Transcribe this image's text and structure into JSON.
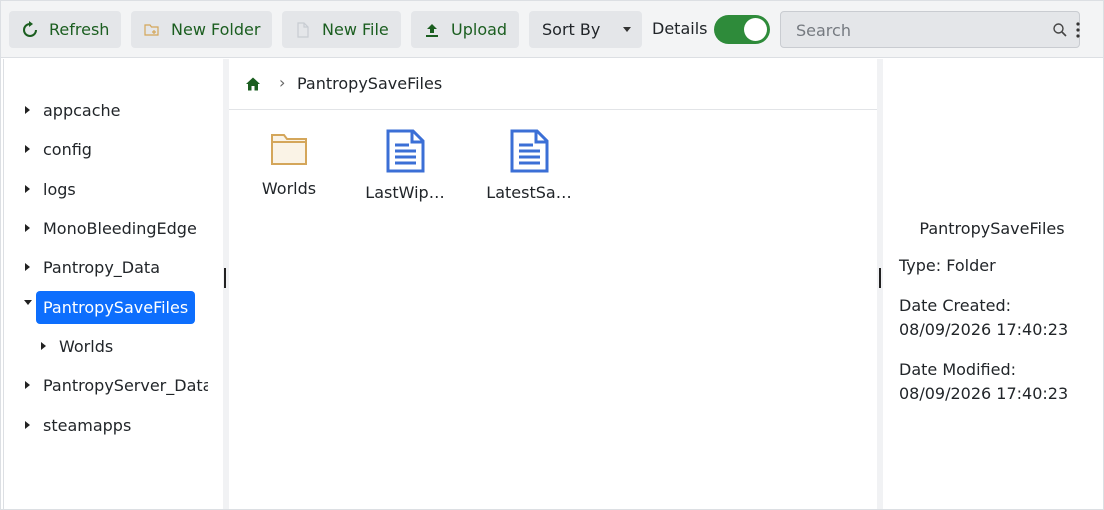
{
  "toolbar": {
    "refresh_label": "Refresh",
    "new_folder_label": "New Folder",
    "new_file_label": "New File",
    "upload_label": "Upload",
    "sort_by_label": "Sort By",
    "details_label": "Details",
    "details_toggle_on": true,
    "search_placeholder": "Search"
  },
  "colors": {
    "accent_green": "#1b5e20",
    "toggle_green": "#2e8b3a",
    "selection_blue": "#0d6efd",
    "folder_tan": "#d4a65a",
    "file_blue": "#3b6fd6"
  },
  "sidebar": {
    "items": [
      {
        "label": "appcache",
        "expanded": false
      },
      {
        "label": "config",
        "expanded": false
      },
      {
        "label": "logs",
        "expanded": false
      },
      {
        "label": "MonoBleedingEdge",
        "expanded": false
      },
      {
        "label": "Pantropy_Data",
        "expanded": false
      },
      {
        "label": "PantropySaveFiles",
        "expanded": true,
        "selected": true
      },
      {
        "label": "Worlds",
        "expanded": false,
        "child": true
      },
      {
        "label": "PantropyServer_Data",
        "expanded": false
      },
      {
        "label": "steamapps",
        "expanded": false
      }
    ]
  },
  "breadcrumb": {
    "home_icon": "home-icon",
    "current": "PantropySaveFiles"
  },
  "files": [
    {
      "name": "Worlds",
      "icon": "folder-icon"
    },
    {
      "name": "LastWip…",
      "icon": "file-icon"
    },
    {
      "name": "LatestSa…",
      "icon": "file-icon"
    }
  ],
  "details": {
    "name": "PantropySaveFiles",
    "type_line": "Type: Folder",
    "created_label": "Date Created:",
    "created_value": "08/09/2026 17:40:23",
    "modified_label": "Date Modified:",
    "modified_value": "08/09/2026 17:40:23"
  }
}
